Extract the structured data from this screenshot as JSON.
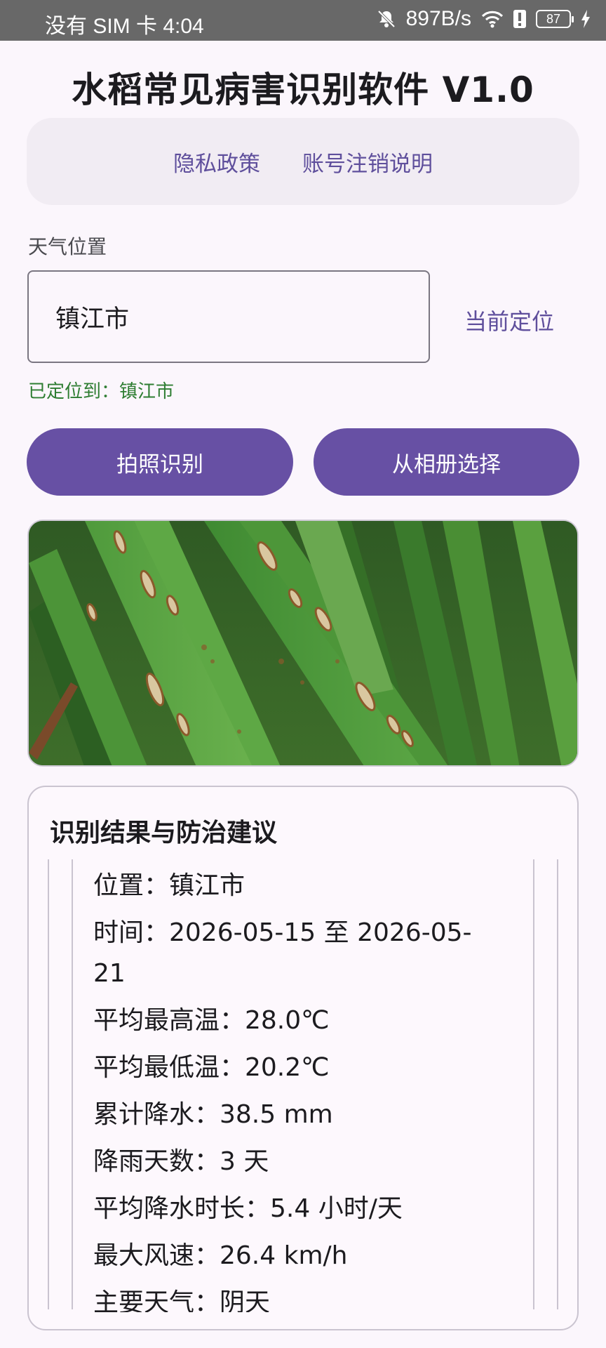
{
  "status_bar": {
    "carrier_time": "没有 SIM 卡 4:04",
    "net_speed": "897B/s",
    "battery": "87"
  },
  "app": {
    "title": "水稻常见病害识别软件 V1.0"
  },
  "links": {
    "privacy": "隐私政策",
    "account_cancel": "账号注销说明"
  },
  "weather": {
    "label": "天气位置",
    "location_value": "镇江市",
    "locate_button": "当前定位",
    "located_status": "已定位到：镇江市"
  },
  "actions": {
    "camera": "拍照识别",
    "album": "从相册选择"
  },
  "result": {
    "title": "识别结果与防治建议",
    "lines": [
      "位置：镇江市",
      "时间：2026-05-15 至 2026-05-21",
      "平均最高温：28.0℃",
      "平均最低温：20.2℃",
      "累计降水：38.5 mm",
      "降雨天数：3 天",
      "平均降水时长：5.4 小时/天",
      "最大风速：26.4 km/h",
      "主要天气：阴天"
    ]
  },
  "colors": {
    "primary": "#6750a4",
    "link": "#5f4f9c",
    "success_text": "#2e7d32",
    "background": "#fbf6fc"
  }
}
